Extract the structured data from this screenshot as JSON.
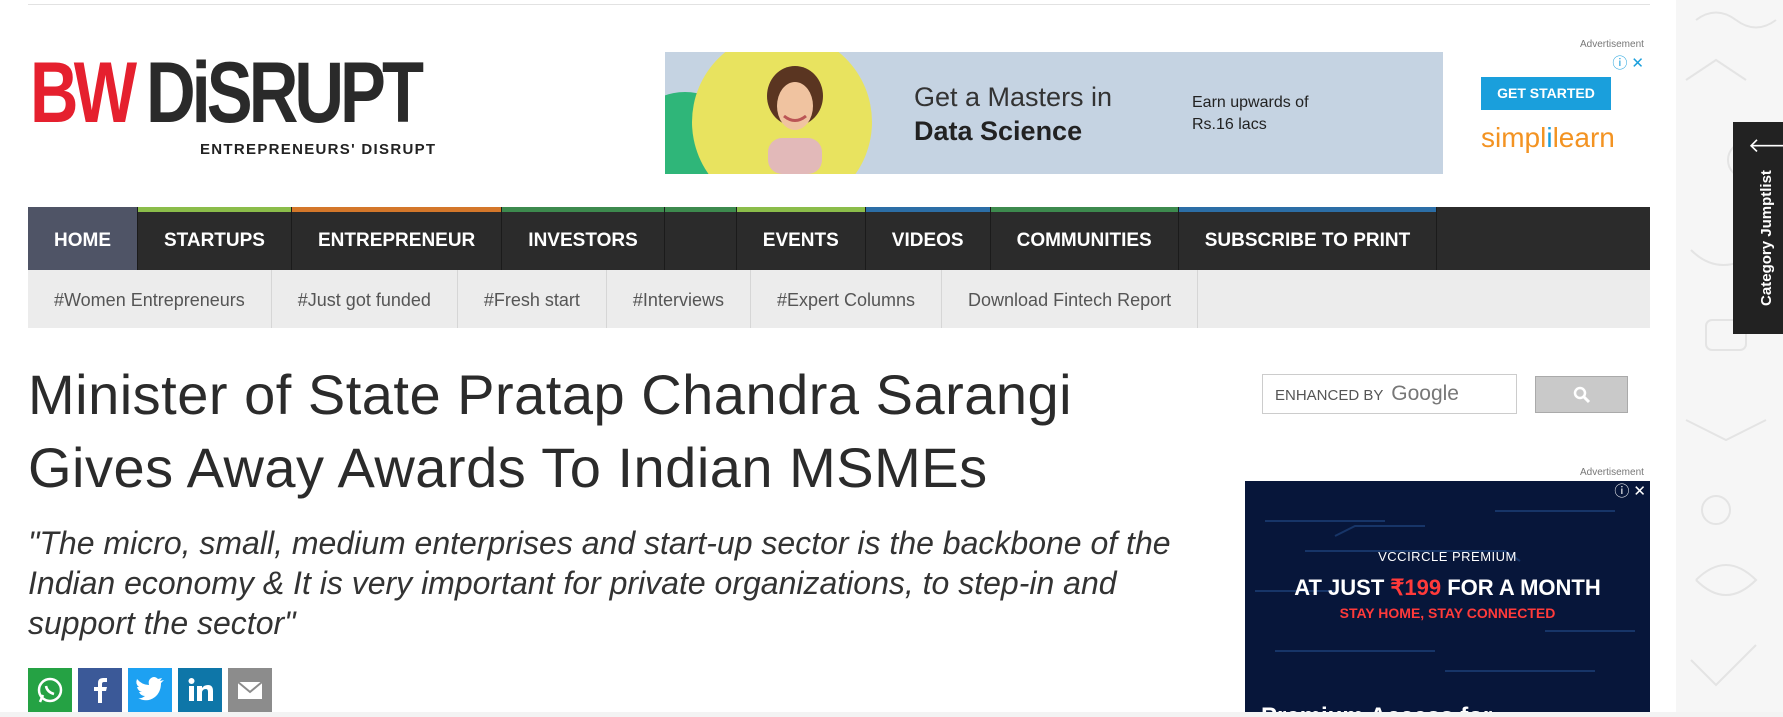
{
  "logo": {
    "bw": "BW",
    "disrupt": "DiSRUPT",
    "tagline": "ENTREPRENEURS' DISRUPT"
  },
  "top_ad": {
    "label": "Advertisement",
    "headline1": "Get a Masters in",
    "headline2": "Data Science",
    "earn1": "Earn upwards of",
    "earn2": "Rs.16 lacs",
    "cta": "GET STARTED",
    "brand_a": "simpl",
    "brand_b": "i",
    "brand_c": "learn"
  },
  "nav": {
    "items": [
      {
        "label": "HOME",
        "color": "#4f5466"
      },
      {
        "label": "STARTUPS",
        "color": "#8bbd4a"
      },
      {
        "label": "ENTREPRENEUR",
        "color": "#d4772a"
      },
      {
        "label": "INVESTORS",
        "color": "#3d8a4e"
      },
      {
        "label": "",
        "color": "#3d8a4e"
      },
      {
        "label": "EVENTS",
        "color": "#8bbd4a"
      },
      {
        "label": "VIDEOS",
        "color": "#2c6ea6"
      },
      {
        "label": "COMMUNITIES",
        "color": "#3d8a4e"
      },
      {
        "label": "SUBSCRIBE TO PRINT",
        "color": "#2c6ea6"
      }
    ]
  },
  "subnav": {
    "items": [
      "#Women Entrepreneurs",
      "#Just got funded",
      "#Fresh start",
      "#Interviews",
      "#Expert Columns",
      "Download Fintech Report"
    ]
  },
  "article": {
    "title": "Minister of State Pratap Chandra Sarangi Gives Away Awards To Indian MSMEs",
    "summary": "\"The micro, small, medium enterprises and start-up sector is the backbone of the Indian economy & It is very important for private organizations, to step-in and support the sector\""
  },
  "share": {
    "icons": [
      "whatsapp-icon",
      "facebook-icon",
      "twitter-icon",
      "linkedin-icon",
      "email-icon"
    ],
    "colors": [
      "#25a244",
      "#3b5998",
      "#1da1f2",
      "#0e76a8",
      "#8c8c8c"
    ]
  },
  "search": {
    "prefix": "ENHANCED BY",
    "brand": "Google"
  },
  "side_ad": {
    "label": "Advertisement",
    "line1": "VCCIRCLE PREMIUM",
    "line2a": "AT JUST ",
    "line2b": "₹199",
    "line2c": " FOR A MONTH",
    "line3": "STAY HOME, STAY CONNECTED",
    "line4": "Premium Access for"
  },
  "jumplist": {
    "label": "Category Jumptlist"
  }
}
